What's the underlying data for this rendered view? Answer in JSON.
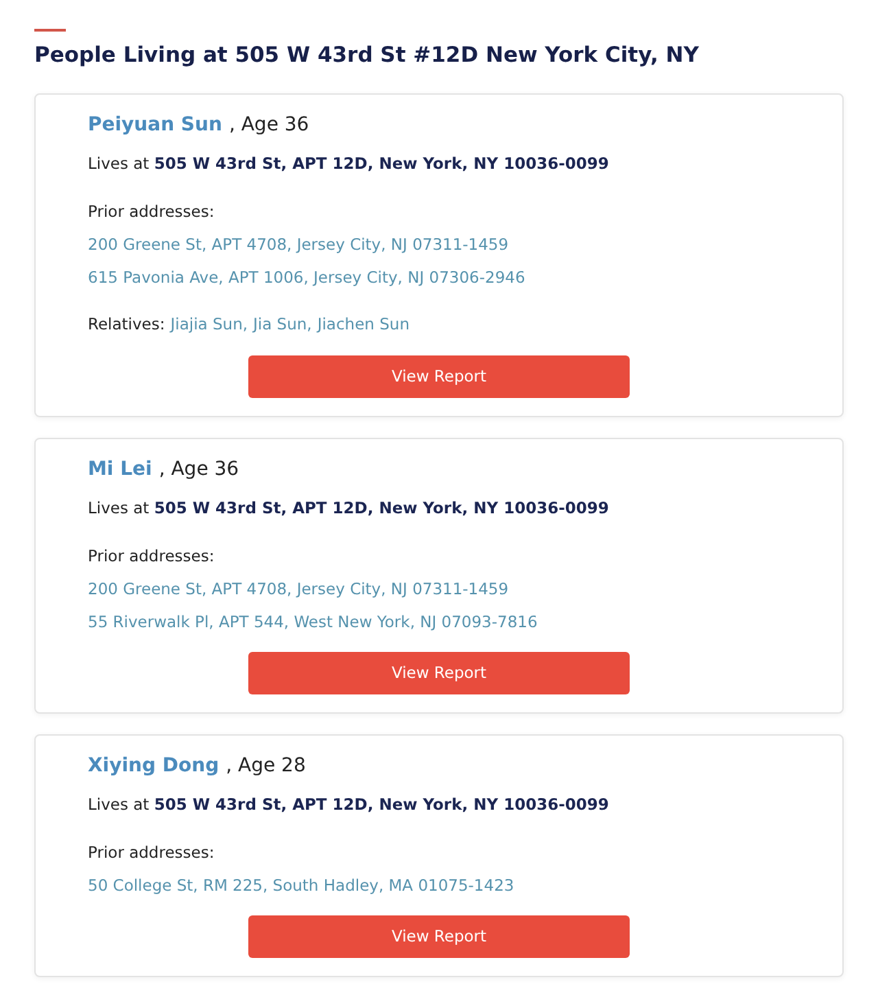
{
  "heading": {
    "title": "People Living at 505 W 43rd St #12D New York City, NY"
  },
  "people": [
    {
      "name": "Peiyuan Sun",
      "age": ", Age 36",
      "residence": "Lives at **505 W 43rd St, APT 12D, New York, NY 10036-0099**",
      "prior_label": "Prior addresses:",
      "prior_addresses": [
        "200 Greene St, APT 4708, Jersey City, NJ 07311-1459",
        "615 Pavonia Ave, APT 1006, Jersey City, NJ 07306-2946"
      ],
      "relatives_label": "Relatives:",
      "relatives": [
        "Jiajia Sun,",
        "Jia Sun,",
        "Jiachen Sun"
      ],
      "button": "View Report"
    },
    {
      "name": "Mi Lei",
      "age": ", Age 36",
      "residence": "Lives at **505 W 43rd St, APT 12D, New York, NY 10036-0099**",
      "prior_label": "Prior addresses:",
      "prior_addresses": [
        "200 Greene St, APT 4708, Jersey City, NJ 07311-1459",
        "55 Riverwalk Pl, APT 544, West New York, NJ 07093-7816"
      ],
      "button": "View Report"
    },
    {
      "name": "Xiying Dong",
      "age": ", Age 28",
      "residence": "Lives at **505 W 43rd St, APT 12D, New York, NY 10036-0099**",
      "prior_label": "Prior addresses:",
      "prior_addresses": [
        "50 College St, RM 225, South Hadley, MA 01075-1423"
      ],
      "button": "View Report"
    }
  ]
}
